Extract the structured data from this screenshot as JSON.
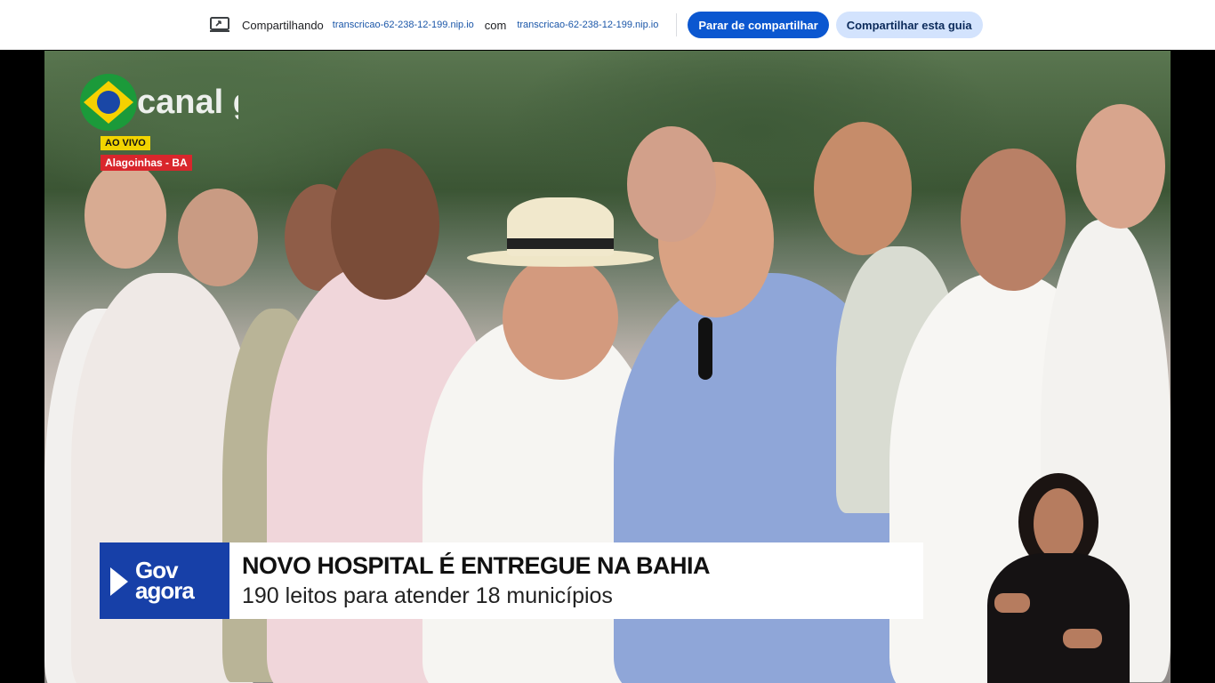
{
  "share_bar": {
    "label": "Compartilhando",
    "url_shared": "transcricao-62-238-12-199.nip.io",
    "with_label": "com",
    "url_with": "transcricao-62-238-12-199.nip.io",
    "stop_button": "Parar de compartilhar",
    "share_tab_button": "Compartilhar esta guia"
  },
  "video": {
    "logo_text": "canal gov",
    "live_badge": "AO VIVO",
    "location_badge": "Alagoinhas - BA",
    "lower_third": {
      "brand_line1": "Gov",
      "brand_line2": "agora",
      "headline": "NOVO HOSPITAL É ENTREGUE NA BAHIA",
      "subline": "190 leitos para atender 18 municípios"
    }
  }
}
